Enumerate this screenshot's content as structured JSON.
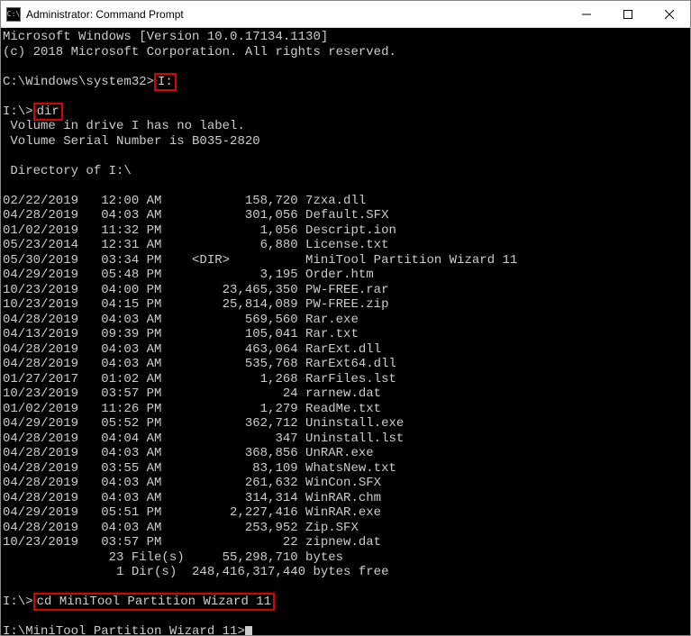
{
  "window": {
    "title": "Administrator: Command Prompt"
  },
  "header": {
    "line1": "Microsoft Windows [Version 10.0.17134.1130]",
    "line2": "(c) 2018 Microsoft Corporation. All rights reserved."
  },
  "prompt1": {
    "path": "C:\\Windows\\system32>",
    "cmd": "I:"
  },
  "prompt2": {
    "path": "I:\\>",
    "cmd": "dir"
  },
  "volume": {
    "line1": " Volume in drive I has no label.",
    "line2": " Volume Serial Number is B035-2820"
  },
  "dirHeader": " Directory of I:\\",
  "files": [
    {
      "date": "02/22/2019",
      "time": "12:00 AM",
      "isDir": false,
      "size": "158,720",
      "name": "7zxa.dll"
    },
    {
      "date": "04/28/2019",
      "time": "04:03 AM",
      "isDir": false,
      "size": "301,056",
      "name": "Default.SFX"
    },
    {
      "date": "01/02/2019",
      "time": "11:32 PM",
      "isDir": false,
      "size": "1,056",
      "name": "Descript.ion"
    },
    {
      "date": "05/23/2014",
      "time": "12:31 AM",
      "isDir": false,
      "size": "6,880",
      "name": "License.txt"
    },
    {
      "date": "05/30/2019",
      "time": "03:34 PM",
      "isDir": true,
      "size": "",
      "name": "MiniTool Partition Wizard 11"
    },
    {
      "date": "04/29/2019",
      "time": "05:48 PM",
      "isDir": false,
      "size": "3,195",
      "name": "Order.htm"
    },
    {
      "date": "10/23/2019",
      "time": "04:00 PM",
      "isDir": false,
      "size": "23,465,350",
      "name": "PW-FREE.rar"
    },
    {
      "date": "10/23/2019",
      "time": "04:15 PM",
      "isDir": false,
      "size": "25,814,089",
      "name": "PW-FREE.zip"
    },
    {
      "date": "04/28/2019",
      "time": "04:03 AM",
      "isDir": false,
      "size": "569,560",
      "name": "Rar.exe"
    },
    {
      "date": "04/13/2019",
      "time": "09:39 PM",
      "isDir": false,
      "size": "105,041",
      "name": "Rar.txt"
    },
    {
      "date": "04/28/2019",
      "time": "04:03 AM",
      "isDir": false,
      "size": "463,064",
      "name": "RarExt.dll"
    },
    {
      "date": "04/28/2019",
      "time": "04:03 AM",
      "isDir": false,
      "size": "535,768",
      "name": "RarExt64.dll"
    },
    {
      "date": "01/27/2017",
      "time": "01:02 AM",
      "isDir": false,
      "size": "1,268",
      "name": "RarFiles.lst"
    },
    {
      "date": "10/23/2019",
      "time": "03:57 PM",
      "isDir": false,
      "size": "24",
      "name": "rarnew.dat"
    },
    {
      "date": "01/02/2019",
      "time": "11:26 PM",
      "isDir": false,
      "size": "1,279",
      "name": "ReadMe.txt"
    },
    {
      "date": "04/29/2019",
      "time": "05:52 PM",
      "isDir": false,
      "size": "362,712",
      "name": "Uninstall.exe"
    },
    {
      "date": "04/28/2019",
      "time": "04:04 AM",
      "isDir": false,
      "size": "347",
      "name": "Uninstall.lst"
    },
    {
      "date": "04/28/2019",
      "time": "04:03 AM",
      "isDir": false,
      "size": "368,856",
      "name": "UnRAR.exe"
    },
    {
      "date": "04/28/2019",
      "time": "03:55 AM",
      "isDir": false,
      "size": "83,109",
      "name": "WhatsNew.txt"
    },
    {
      "date": "04/28/2019",
      "time": "04:03 AM",
      "isDir": false,
      "size": "261,632",
      "name": "WinCon.SFX"
    },
    {
      "date": "04/28/2019",
      "time": "04:03 AM",
      "isDir": false,
      "size": "314,314",
      "name": "WinRAR.chm"
    },
    {
      "date": "04/29/2019",
      "time": "05:51 PM",
      "isDir": false,
      "size": "2,227,416",
      "name": "WinRAR.exe"
    },
    {
      "date": "04/28/2019",
      "time": "04:03 AM",
      "isDir": false,
      "size": "253,952",
      "name": "Zip.SFX"
    },
    {
      "date": "10/23/2019",
      "time": "03:57 PM",
      "isDir": false,
      "size": "22",
      "name": "zipnew.dat"
    }
  ],
  "summary": {
    "filesLine": "              23 File(s)     55,298,710 bytes",
    "dirsLine": "               1 Dir(s)  248,416,317,440 bytes free"
  },
  "prompt3": {
    "path": "I:\\>",
    "cmd": "cd MiniTool Partition Wizard 11"
  },
  "prompt4": {
    "path": "I:\\MiniTool Partition Wizard 11>"
  }
}
